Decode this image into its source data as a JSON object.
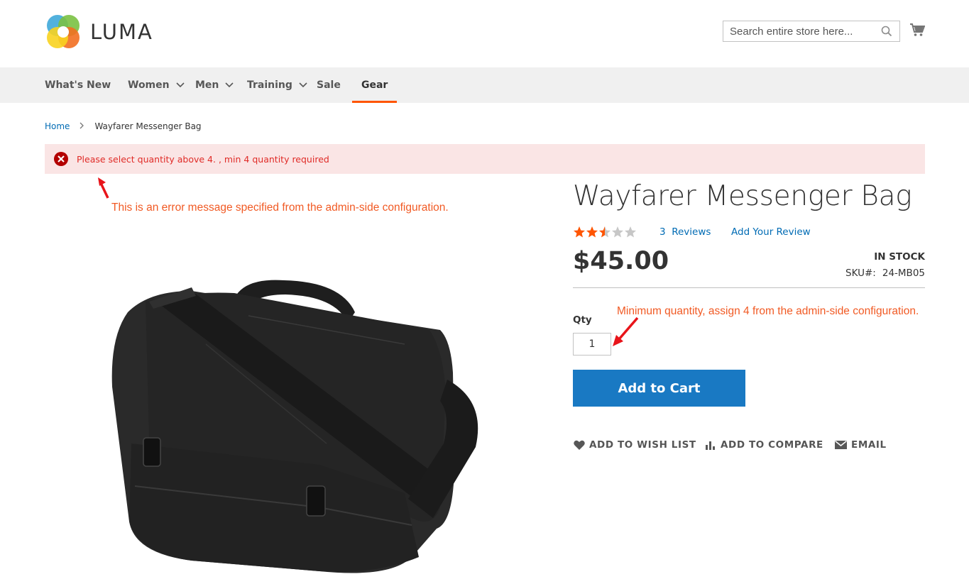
{
  "header": {
    "logo_text": "LUMA",
    "search_placeholder": "Search entire store here..."
  },
  "nav": {
    "items": [
      {
        "label": "What's New",
        "has_dropdown": false
      },
      {
        "label": "Women",
        "has_dropdown": true
      },
      {
        "label": "Men",
        "has_dropdown": true
      },
      {
        "label": "Training",
        "has_dropdown": true
      },
      {
        "label": "Sale",
        "has_dropdown": false
      },
      {
        "label": "Gear",
        "has_dropdown": false,
        "active": true
      }
    ]
  },
  "breadcrumb": {
    "home": "Home",
    "separator": ">",
    "current": "Wayfarer Messenger Bag"
  },
  "error_message": "Please select quantity above 4. , min 4 quantity required",
  "annotations": {
    "error_note": "This is an error message specified from the admin-side configuration.",
    "qty_note": "Minimum quantity, assign 4 from the admin-side configuration."
  },
  "product": {
    "title": "Wayfarer Messenger Bag",
    "rating_fraction": 0.6,
    "reviews_count": "3",
    "reviews_label": "Reviews",
    "add_review": "Add Your Review",
    "price": "$45.00",
    "stock": "IN STOCK",
    "sku_label": "SKU#:",
    "sku_value": "24-MB05",
    "qty_label": "Qty",
    "qty_value": "1",
    "add_to_cart": "Add to Cart"
  },
  "actions": {
    "wishlist": "ADD TO WISH LIST",
    "compare": "ADD TO COMPARE",
    "email": "EMAIL"
  },
  "colors": {
    "accent_orange": "#ff5501",
    "link_blue": "#006bb4",
    "button_blue": "#1979c3",
    "error_red": "#e02b27",
    "error_bg": "#fae5e5",
    "annotation": "#f15a24"
  }
}
